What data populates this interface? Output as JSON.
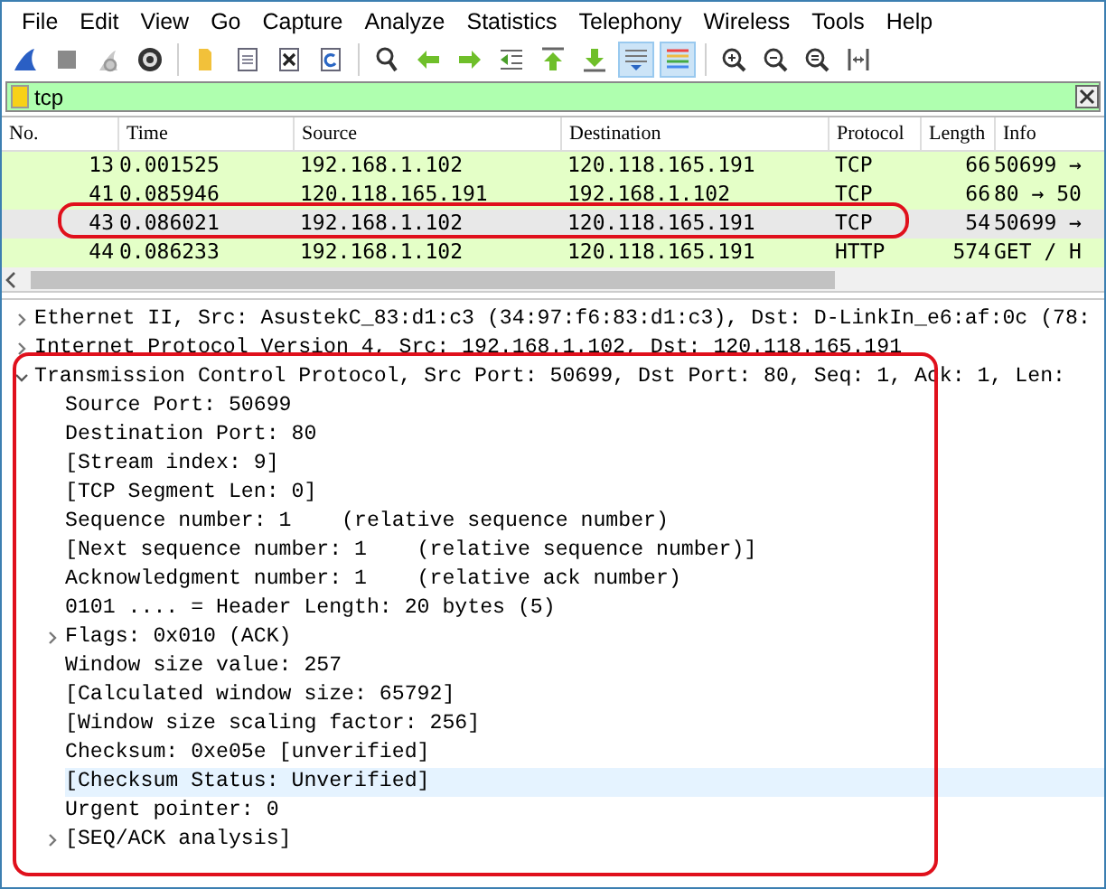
{
  "menu": [
    "File",
    "Edit",
    "View",
    "Go",
    "Capture",
    "Analyze",
    "Statistics",
    "Telephony",
    "Wireless",
    "Tools",
    "Help"
  ],
  "toolbar": [
    [
      {
        "kind": "fin",
        "on": false
      },
      {
        "kind": "stop",
        "on": false
      },
      {
        "kind": "restart",
        "on": false
      },
      {
        "kind": "options",
        "on": false
      }
    ],
    [
      {
        "kind": "open",
        "on": false
      },
      {
        "kind": "file",
        "on": false
      },
      {
        "kind": "close",
        "on": false
      },
      {
        "kind": "reload",
        "on": false
      }
    ],
    [
      {
        "kind": "find",
        "on": false
      },
      {
        "kind": "back",
        "on": false
      },
      {
        "kind": "forward",
        "on": false
      },
      {
        "kind": "goto",
        "on": false
      },
      {
        "kind": "first",
        "on": false
      },
      {
        "kind": "last",
        "on": false
      },
      {
        "kind": "autoscroll",
        "on": true
      },
      {
        "kind": "colorize",
        "on": true
      }
    ],
    [
      {
        "kind": "zoomin",
        "on": false
      },
      {
        "kind": "zoomout",
        "on": false
      },
      {
        "kind": "zoomreset",
        "on": false
      },
      {
        "kind": "resize",
        "on": false
      }
    ]
  ],
  "filter": {
    "value": "tcp",
    "valid": true
  },
  "packet_list": {
    "columns": [
      "No.",
      "Time",
      "Source",
      "Destination",
      "Protocol",
      "Length",
      "Info"
    ],
    "rows": [
      {
        "no": "13",
        "time": "0.001525",
        "source": "192.168.1.102",
        "destination": "120.118.165.191",
        "protocol": "TCP",
        "length": "66",
        "info": "50699 →",
        "selected": false
      },
      {
        "no": "41",
        "time": "0.085946",
        "source": "120.118.165.191",
        "destination": "192.168.1.102",
        "protocol": "TCP",
        "length": "66",
        "info": "80 → 50",
        "selected": false
      },
      {
        "no": "43",
        "time": "0.086021",
        "source": "192.168.1.102",
        "destination": "120.118.165.191",
        "protocol": "TCP",
        "length": "54",
        "info": "50699 →",
        "selected": true
      },
      {
        "no": "44",
        "time": "0.086233",
        "source": "192.168.1.102",
        "destination": "120.118.165.191",
        "protocol": "HTTP",
        "length": "574",
        "info": "GET / H",
        "selected": false
      }
    ]
  },
  "details": [
    {
      "text": "Ethernet II, Src: AsustekC_83:d1:c3 (34:97:f6:83:d1:c3), Dst: D-LinkIn_e6:af:0c (78:",
      "expanded": false,
      "selected": false
    },
    {
      "text": "Internet Protocol Version 4, Src: 192.168.1.102, Dst: 120.118.165.191",
      "expanded": false,
      "selected": false
    },
    {
      "text": "Transmission Control Protocol, Src Port: 50699, Dst Port: 80, Seq: 1, Ack: 1, Len:",
      "expanded": true,
      "selected": false,
      "children": [
        {
          "text": "Source Port: 50699",
          "selected": false
        },
        {
          "text": "Destination Port: 80",
          "selected": false
        },
        {
          "text": "[Stream index: 9]",
          "selected": false
        },
        {
          "text": "[TCP Segment Len: 0]",
          "selected": false
        },
        {
          "text": "Sequence number: 1    (relative sequence number)",
          "selected": false
        },
        {
          "text": "[Next sequence number: 1    (relative sequence number)]",
          "selected": false
        },
        {
          "text": "Acknowledgment number: 1    (relative ack number)",
          "selected": false
        },
        {
          "text": "0101 .... = Header Length: 20 bytes (5)",
          "selected": false
        },
        {
          "text": "Flags: 0x010 (ACK)",
          "expanded": false,
          "selected": false
        },
        {
          "text": "Window size value: 257",
          "selected": false
        },
        {
          "text": "[Calculated window size: 65792]",
          "selected": false
        },
        {
          "text": "[Window size scaling factor: 256]",
          "selected": false
        },
        {
          "text": "Checksum: 0xe05e [unverified]",
          "selected": false
        },
        {
          "text": "[Checksum Status: Unverified]",
          "selected": true
        },
        {
          "text": "Urgent pointer: 0",
          "selected": false
        },
        {
          "text": "[SEQ/ACK analysis]",
          "expanded": false,
          "selected": false
        }
      ]
    }
  ]
}
